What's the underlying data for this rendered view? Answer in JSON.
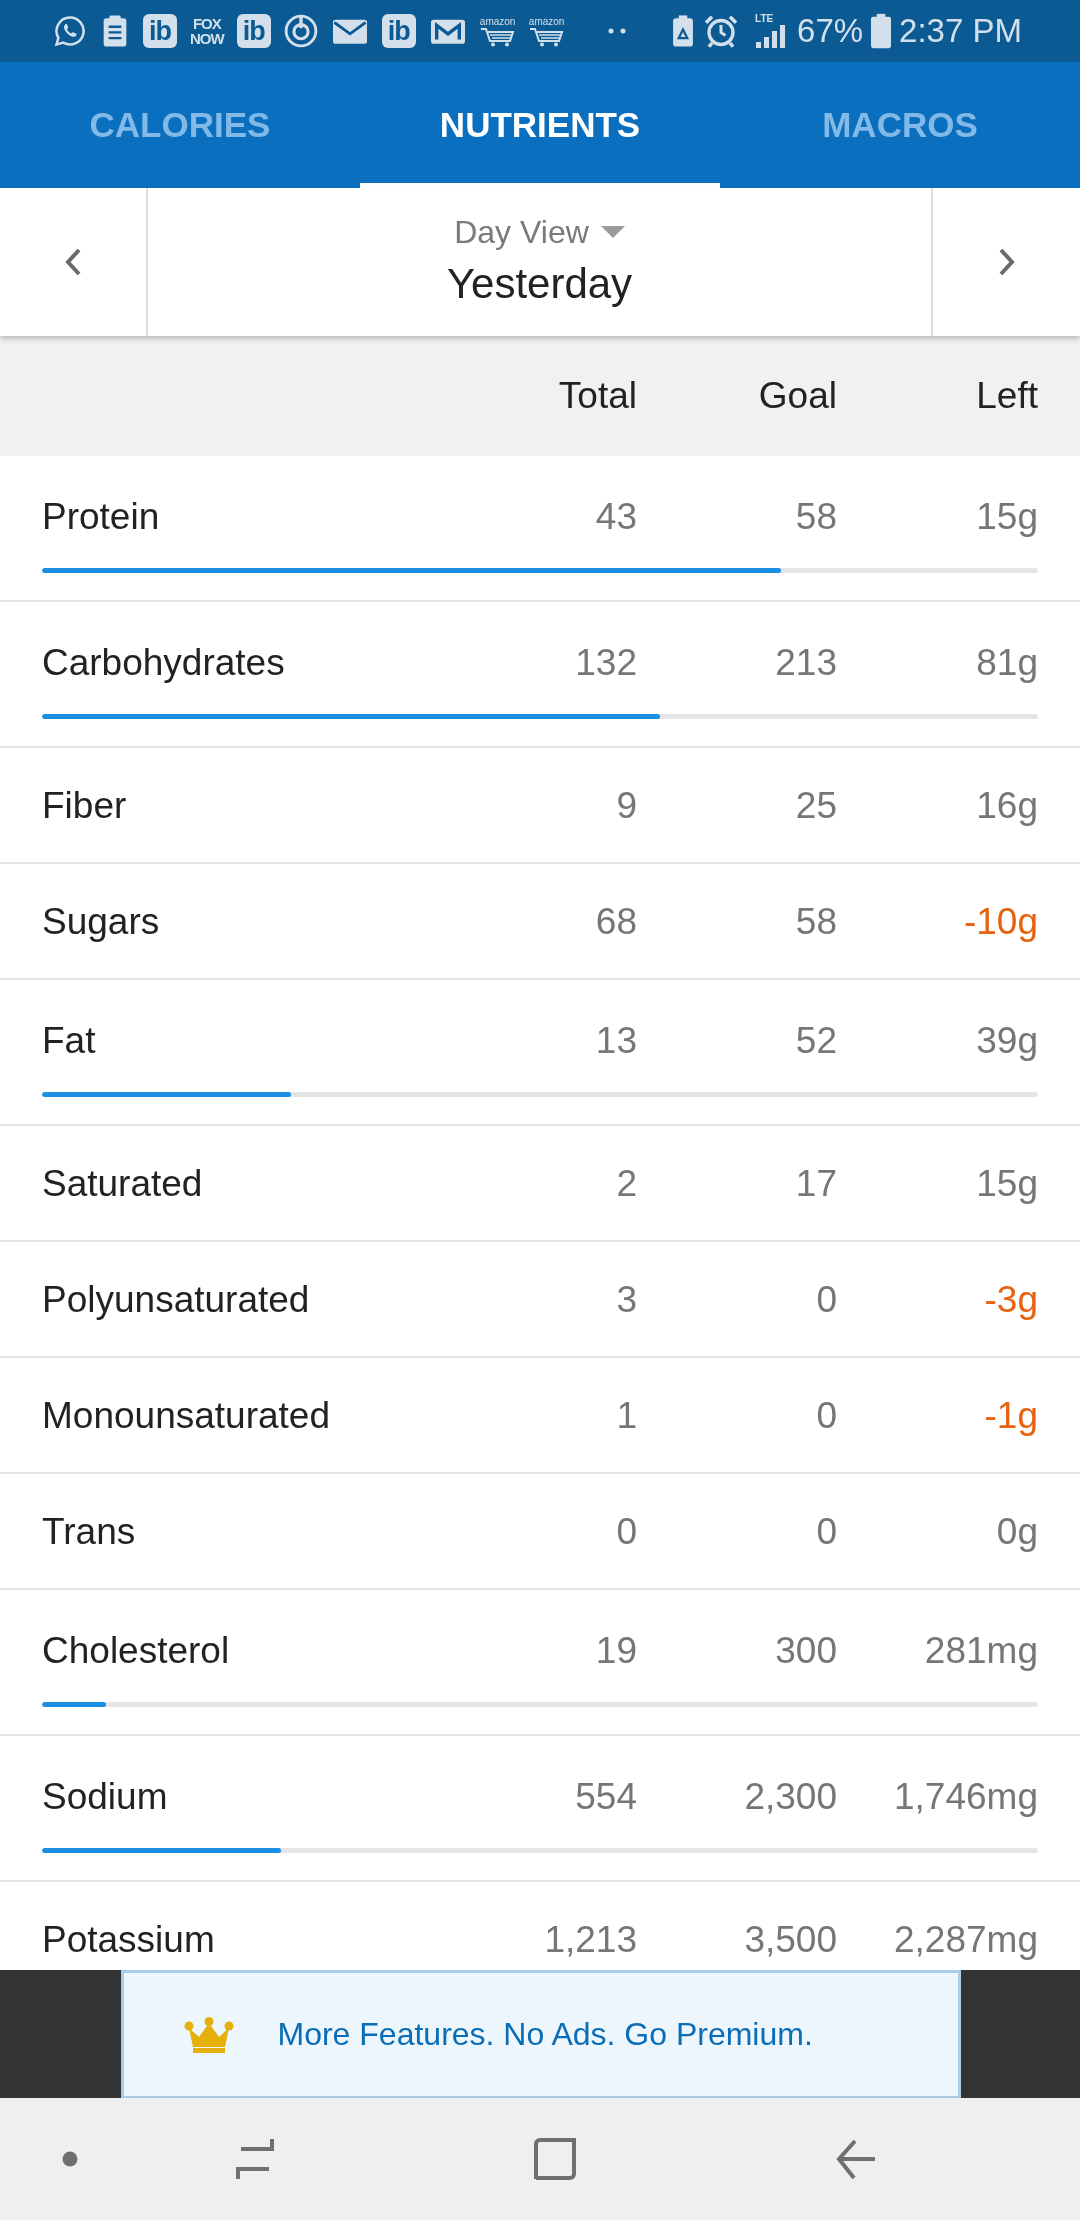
{
  "status_bar": {
    "notifications": [
      {
        "kind": "chat"
      },
      {
        "kind": "clipboard"
      },
      {
        "kind": "badge",
        "text": "ib"
      },
      {
        "kind": "wordmark",
        "text": "FOX NOW"
      },
      {
        "kind": "badge",
        "text": "ib"
      },
      {
        "kind": "power"
      },
      {
        "kind": "mail"
      },
      {
        "kind": "badge",
        "text": "ib"
      },
      {
        "kind": "mail-m"
      },
      {
        "kind": "cart",
        "text": "amazon"
      },
      {
        "kind": "cart",
        "text": "amazon"
      },
      {
        "kind": "more"
      }
    ],
    "network": "LTE",
    "battery": "67%",
    "time": "2:37 PM"
  },
  "tabs": [
    {
      "label": "CALORIES",
      "selected": false
    },
    {
      "label": "NUTRIENTS",
      "selected": true
    },
    {
      "label": "MACROS",
      "selected": false
    }
  ],
  "day_nav": {
    "view": "Day View",
    "date": "Yesterday"
  },
  "table": {
    "columns": [
      "Total",
      "Goal",
      "Left"
    ],
    "rows": [
      {
        "kind": "meter",
        "name": "Protein",
        "total": "43",
        "goal": "58",
        "left": "15g",
        "over_goal": false,
        "level": 0.742
      },
      {
        "kind": "meter",
        "name": "Carbohydrates",
        "total": "132",
        "goal": "213",
        "left": "81g",
        "over_goal": false,
        "level": 0.62
      },
      {
        "kind": "plain",
        "name": "Fiber",
        "total": "9",
        "goal": "25",
        "left": "16g",
        "over_goal": false
      },
      {
        "kind": "plain",
        "name": "Sugars",
        "total": "68",
        "goal": "58",
        "left": "-10g",
        "over_goal": true
      },
      {
        "kind": "meter",
        "name": "Fat",
        "total": "13",
        "goal": "52",
        "left": "39g",
        "over_goal": false,
        "level": 0.25
      },
      {
        "kind": "plain",
        "name": "Saturated",
        "total": "2",
        "goal": "17",
        "left": "15g",
        "over_goal": false
      },
      {
        "kind": "plain",
        "name": "Polyunsaturated",
        "total": "3",
        "goal": "0",
        "left": "-3g",
        "over_goal": true
      },
      {
        "kind": "plain",
        "name": "Monounsaturated",
        "total": "1",
        "goal": "0",
        "left": "-1g",
        "over_goal": true
      },
      {
        "kind": "plain",
        "name": "Trans",
        "total": "0",
        "goal": "0",
        "left": "0g",
        "over_goal": false
      },
      {
        "kind": "meter",
        "name": "Cholesterol",
        "total": "19",
        "goal": "300",
        "left": "281mg",
        "over_goal": false,
        "level": 0.064
      },
      {
        "kind": "meter",
        "name": "Sodium",
        "total": "554",
        "goal": "2,300",
        "left": "1,746mg",
        "over_goal": false,
        "level": 0.24
      },
      {
        "kind": "plain",
        "name": "Potassium",
        "total": "1,213",
        "goal": "3,500",
        "left": "2,287mg",
        "over_goal": false
      }
    ]
  },
  "promo": {
    "text": "More Features. No Ads. Go Premium."
  }
}
